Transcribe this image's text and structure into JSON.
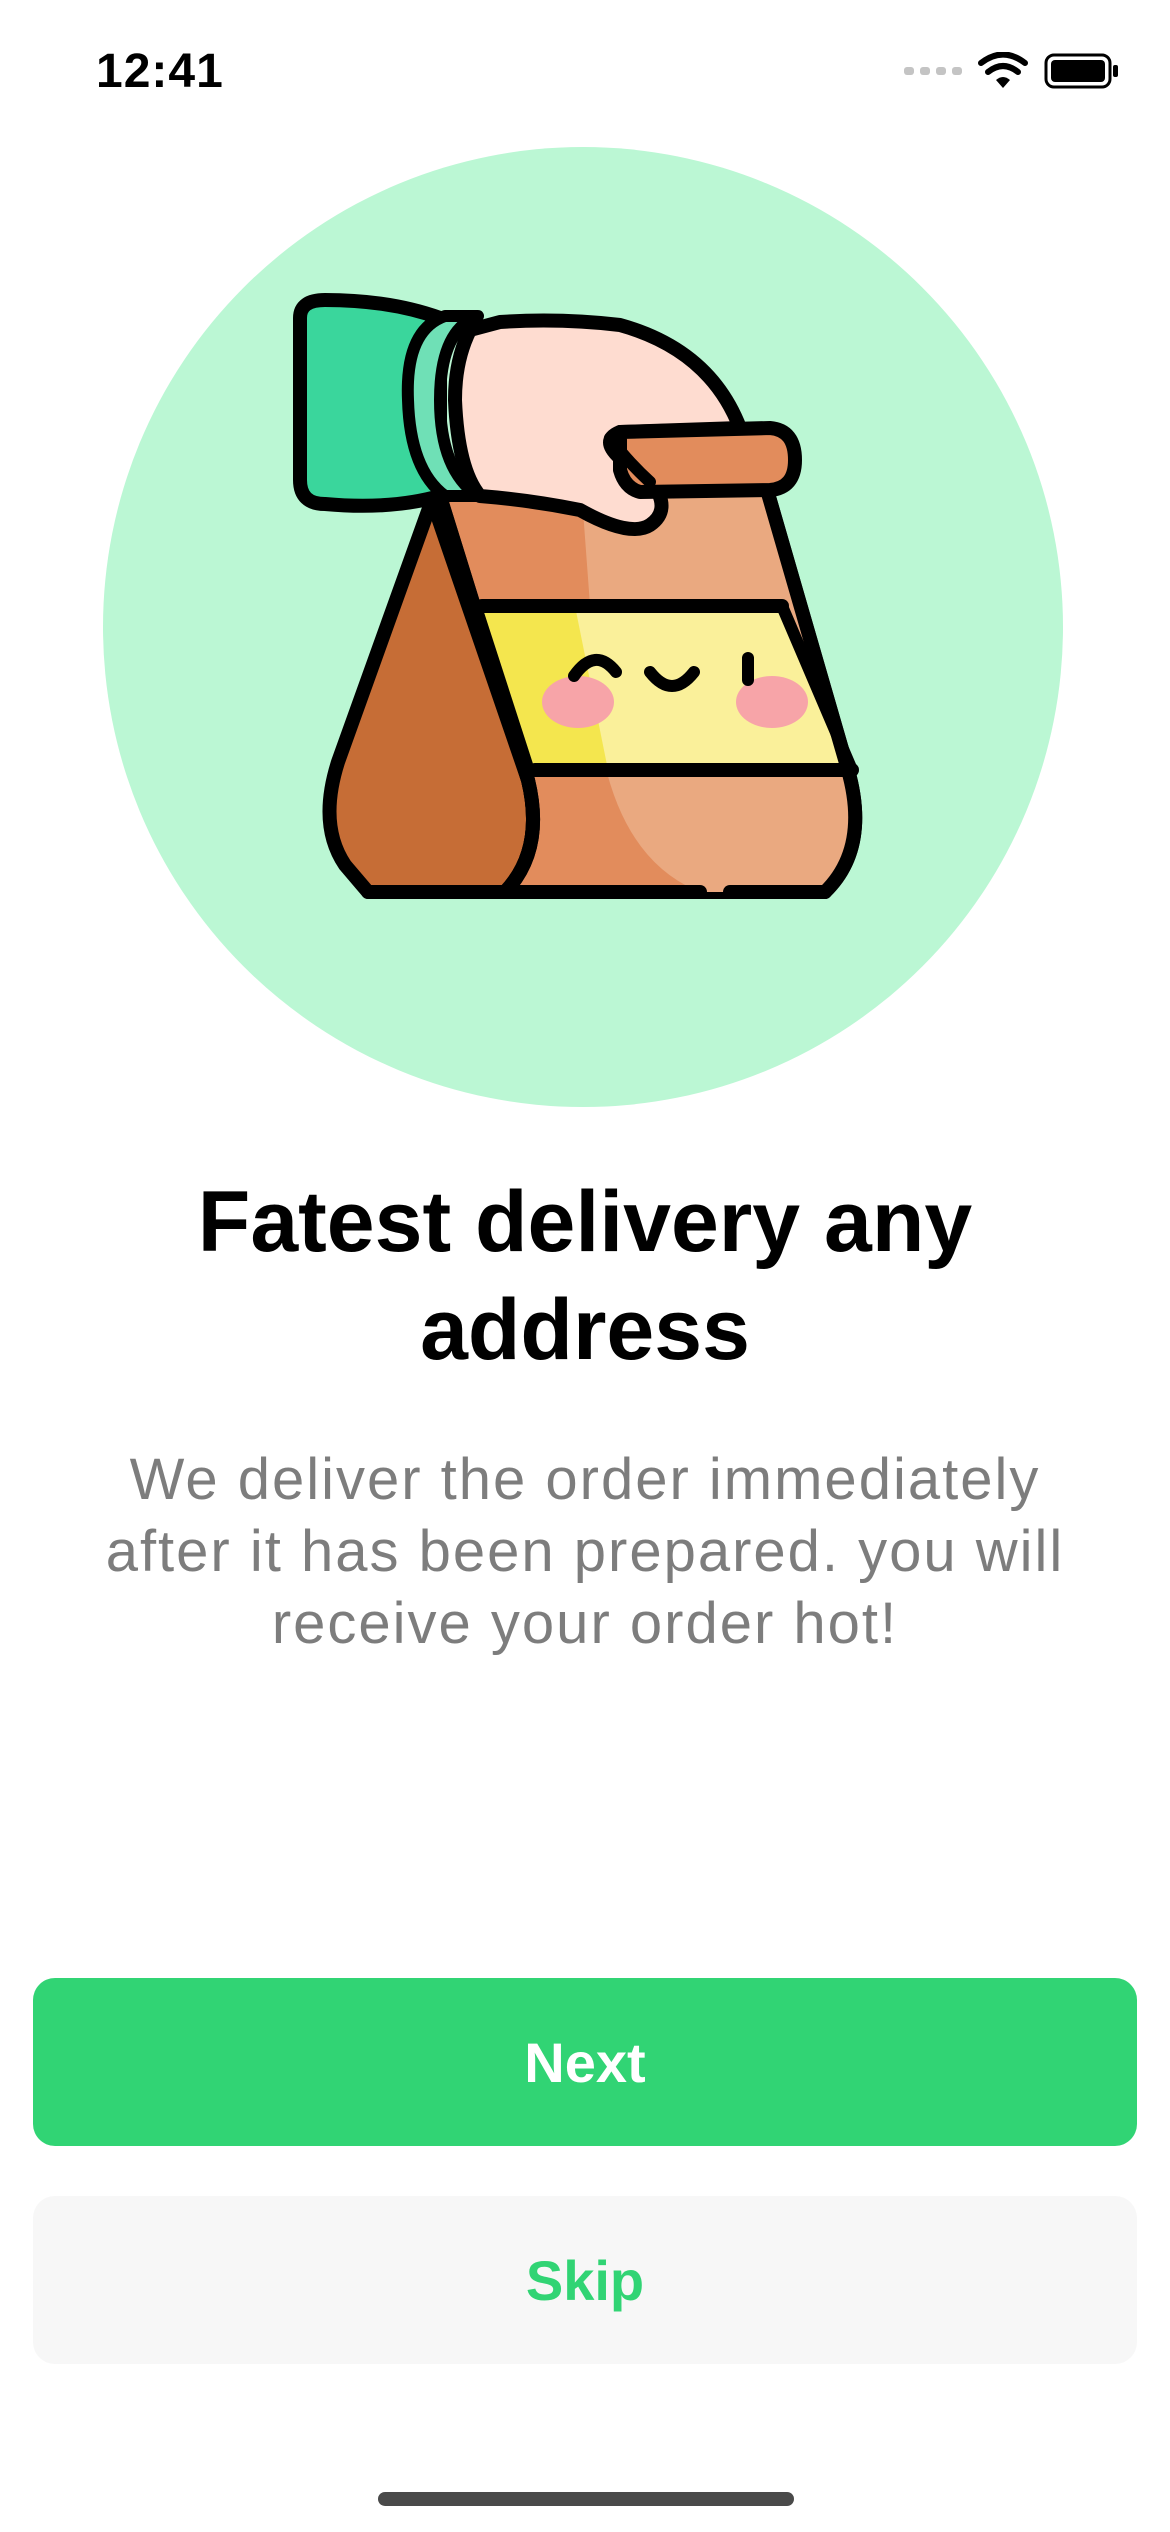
{
  "status_bar": {
    "time": "12:41"
  },
  "onboarding": {
    "illustration_icon": "delivery-bag-icon",
    "title": "Fatest delivery any address",
    "description": "We deliver the order immediately after it has been prepared. you will receive your order hot!"
  },
  "actions": {
    "next_label": "Next",
    "skip_label": "Skip"
  },
  "colors": {
    "accent": "#31d474",
    "circle_bg": "#bbf7d4",
    "description_text": "#7d7d7d",
    "skip_bg": "#f7f7f7"
  }
}
